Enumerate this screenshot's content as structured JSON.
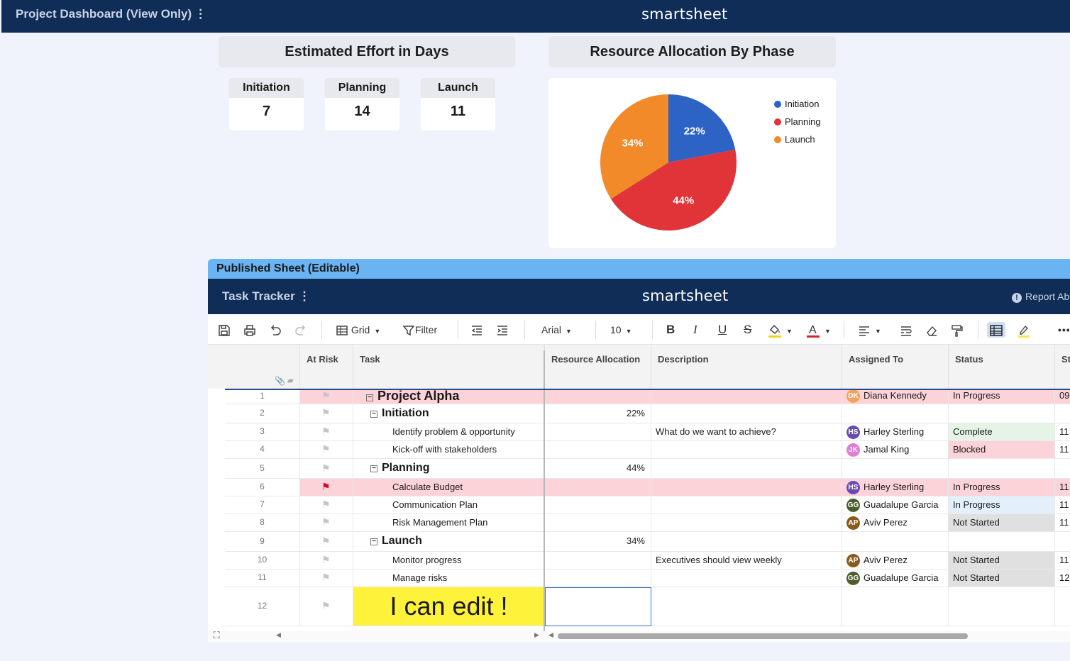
{
  "header": {
    "title": "Project Dashboard (View Only)",
    "menu": "⋮",
    "brand": "smartsheet"
  },
  "effort": {
    "title": "Estimated Effort in Days",
    "kpis": [
      {
        "label": "Initiation",
        "value": "7"
      },
      {
        "label": "Planning",
        "value": "14"
      },
      {
        "label": "Launch",
        "value": "11"
      }
    ]
  },
  "chart_data": {
    "type": "pie",
    "title": "Resource Allocation By Phase",
    "categories": [
      "Initiation",
      "Planning",
      "Launch"
    ],
    "values": [
      22,
      44,
      34
    ],
    "labels": [
      "22%",
      "44%",
      "34%"
    ],
    "colors": [
      "#2c63c4",
      "#e03438",
      "#f38a29"
    ],
    "legend_position": "right"
  },
  "published": {
    "label": "Published Sheet (Editable)"
  },
  "tracker": {
    "title": "Task Tracker",
    "menu": "⋮",
    "brand": "smartsheet",
    "report": "Report Ab"
  },
  "toolbar": {
    "grid_label": "Grid",
    "filter_label": "Filter",
    "font": "Arial",
    "size": "10",
    "bold": "B",
    "italic": "I",
    "underline": "U",
    "strike": "S",
    "textcolor": "A"
  },
  "columns": {
    "at_risk": "At Risk",
    "task": "Task",
    "resource": "Resource Allocation",
    "description": "Description",
    "assigned": "Assigned To",
    "status": "Status",
    "next": "St"
  },
  "rows": [
    {
      "num": "1",
      "task": "Project Alpha",
      "resource": "",
      "desc": "",
      "initials": "DK",
      "assignee": "Diana Kennedy",
      "status": "In Progress",
      "next": "09"
    },
    {
      "num": "2",
      "task": "Initiation",
      "resource": "22%",
      "desc": "",
      "initials": "",
      "assignee": "",
      "status": "",
      "next": ""
    },
    {
      "num": "3",
      "task": "Identify problem & opportunity",
      "resource": "",
      "desc": "What do we want to achieve?",
      "initials": "HS",
      "assignee": "Harley Sterling",
      "status": "Complete",
      "next": "11"
    },
    {
      "num": "4",
      "task": "Kick-off with stakeholders",
      "resource": "",
      "desc": "",
      "initials": "JK",
      "assignee": "Jamal King",
      "status": "Blocked",
      "next": "11"
    },
    {
      "num": "5",
      "task": "Planning",
      "resource": "44%",
      "desc": "",
      "initials": "",
      "assignee": "",
      "status": "",
      "next": ""
    },
    {
      "num": "6",
      "task": "Calculate Budget",
      "resource": "",
      "desc": "",
      "initials": "HS",
      "assignee": "Harley Sterling",
      "status": "In Progress",
      "next": "11"
    },
    {
      "num": "7",
      "task": "Communication Plan",
      "resource": "",
      "desc": "",
      "initials": "GG",
      "assignee": "Guadalupe Garcia",
      "status": "In Progress",
      "next": "11"
    },
    {
      "num": "8",
      "task": "Risk Management Plan",
      "resource": "",
      "desc": "",
      "initials": "AP",
      "assignee": "Aviv Perez",
      "status": "Not Started",
      "next": "11"
    },
    {
      "num": "9",
      "task": "Launch",
      "resource": "34%",
      "desc": "",
      "initials": "",
      "assignee": "",
      "status": "",
      "next": ""
    },
    {
      "num": "10",
      "task": "Monitor progress",
      "resource": "",
      "desc": "Executives should view weekly",
      "initials": "AP",
      "assignee": "Aviv Perez",
      "status": "Not Started",
      "next": "11"
    },
    {
      "num": "11",
      "task": "Manage risks",
      "resource": "",
      "desc": "",
      "initials": "GG",
      "assignee": "Guadalupe Garcia",
      "status": "Not Started",
      "next": "12"
    },
    {
      "num": "12",
      "task": "I can edit !",
      "resource": "",
      "desc": "",
      "initials": "",
      "assignee": "",
      "status": "",
      "next": ""
    }
  ],
  "colors": {
    "navy": "#0f2d57",
    "published": "#6bb4f4",
    "at_risk_row": "#fbd3d9",
    "complete": "#e6f4e7",
    "blocked": "#fbd3d9",
    "in_progress_blue": "#e3f0fc",
    "not_started": "#e0e0e0",
    "highlight": "#fff23a"
  }
}
